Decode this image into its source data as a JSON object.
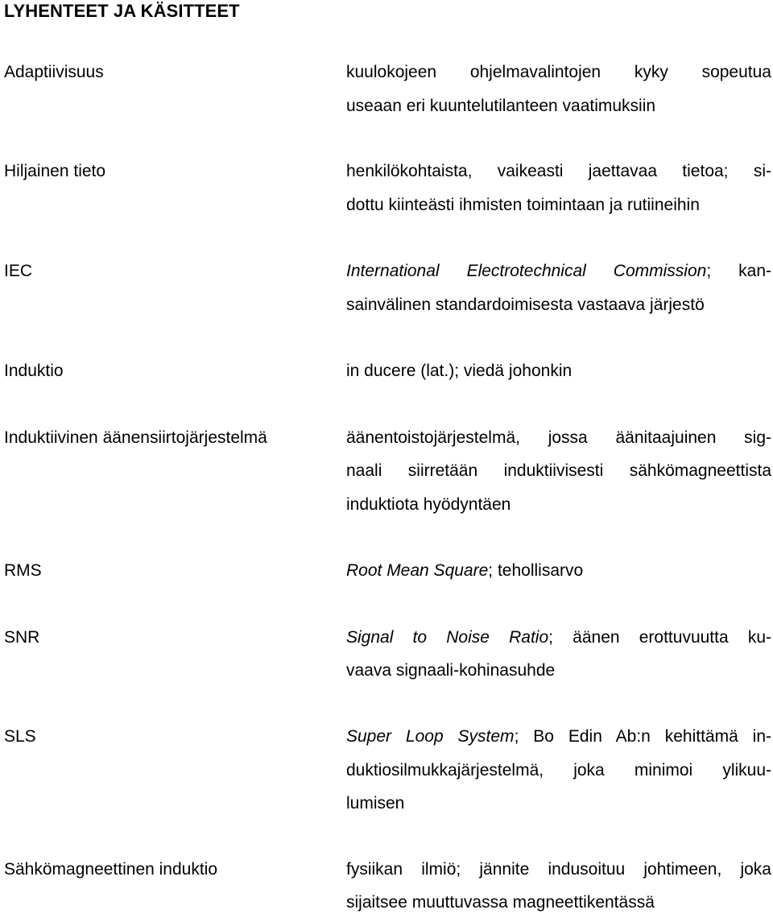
{
  "page": {
    "title": "LYHENTEET JA KÄSITTEET"
  },
  "entries": [
    {
      "term": "Adaptiivisuus",
      "lines": [
        {
          "italic": "",
          "text": "kuulokojeen ohjelmavalintojen kyky sopeutua"
        },
        {
          "italic": "",
          "text": "useaan eri kuuntelutilanteen vaatimuksiin"
        }
      ]
    },
    {
      "term": "Hiljainen tieto",
      "lines": [
        {
          "italic": "",
          "text": "henkilökohtaista, vaikeasti jaettavaa tietoa; si-"
        },
        {
          "italic": "",
          "text": "dottu kiinteästi ihmisten toimintaan ja rutiineihin"
        }
      ]
    },
    {
      "term": "IEC",
      "lines": [
        {
          "italic": "International Electrotechnical Commission",
          "text": "; kan-"
        },
        {
          "italic": "",
          "text": "sainvälinen standardoimisesta vastaava järjestö"
        }
      ]
    },
    {
      "term": "Induktio",
      "lines": [
        {
          "italic": "",
          "text": "in ducere (lat.); viedä johonkin"
        }
      ]
    },
    {
      "term": "Induktiivinen äänensiirtojärjestelmä",
      "lines": [
        {
          "italic": "",
          "text": "äänentoistojärjestelmä, jossa äänitaajuinen sig-"
        },
        {
          "italic": "",
          "text": "naali siirretään induktiivisesti sähkömagneettista"
        },
        {
          "italic": "",
          "text": "induktiota hyödyntäen"
        }
      ]
    },
    {
      "term": "RMS",
      "lines": [
        {
          "italic": "Root Mean Square",
          "text": "; tehollisarvo"
        }
      ]
    },
    {
      "term": "SNR",
      "lines": [
        {
          "italic": "Signal to Noise Ratio",
          "text": "; äänen erottuvuutta ku-"
        },
        {
          "italic": "",
          "text": "vaava signaali-kohinasuhde"
        }
      ]
    },
    {
      "term": "SLS",
      "lines": [
        {
          "italic": "Super Loop System",
          "text": "; Bo Edin Ab:n kehittämä in-"
        },
        {
          "italic": "",
          "text": "duktiosilmukkajärjestelmä, joka minimoi ylikuu-"
        },
        {
          "italic": "",
          "text": "lumisen"
        }
      ]
    },
    {
      "term": "Sähkömagneettinen induktio",
      "lines": [
        {
          "italic": "",
          "text": "fysiikan ilmiö; jännite indusoituu johtimeen, joka"
        },
        {
          "italic": "",
          "text": "sijaitsee muuttuvassa magneettikentässä"
        }
      ]
    }
  ]
}
